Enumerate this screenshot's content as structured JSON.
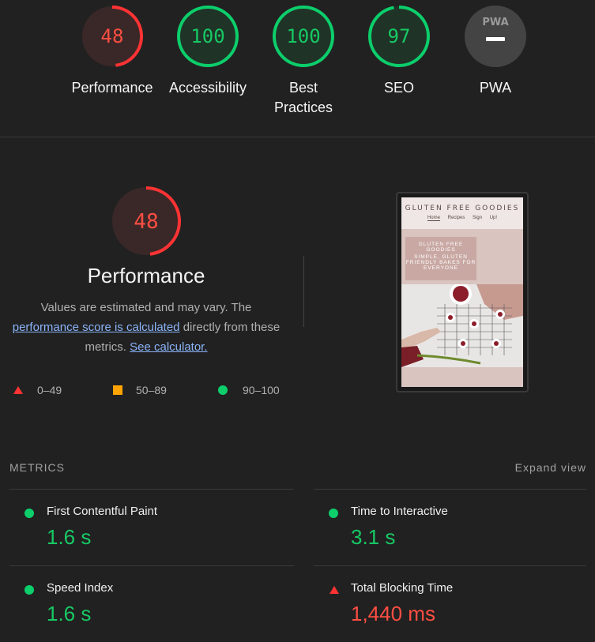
{
  "gauges": [
    {
      "score": "48",
      "label": "Performance",
      "status": "fail",
      "fraction": 0.48
    },
    {
      "score": "100",
      "label": "Accessibility",
      "status": "pass",
      "fraction": 1.0
    },
    {
      "score": "100",
      "label": "Best Practices",
      "status": "pass",
      "fraction": 1.0
    },
    {
      "score": "97",
      "label": "SEO",
      "status": "pass",
      "fraction": 0.97
    },
    {
      "score": "",
      "label": "PWA",
      "status": "na",
      "badge": "PWA"
    }
  ],
  "performance": {
    "score": "48",
    "fraction": 0.48,
    "title": "Performance",
    "desc_before": "Values are estimated and may vary. The",
    "desc_link": "performance score is calculated",
    "desc_middle": "directly from these metrics.",
    "desc_link2": "See calculator."
  },
  "legend": [
    {
      "icon": "triangle-icon",
      "range": "0–49",
      "color": "#ff3333"
    },
    {
      "icon": "square-icon",
      "range": "50–89",
      "color": "#ffa400"
    },
    {
      "icon": "circle-icon",
      "range": "90–100",
      "color": "#0cce6b"
    }
  ],
  "screenshot": {
    "site_title": "GLUTEN FREE GOODIES",
    "nav": [
      "Home",
      "Recipes",
      "Sign Up!"
    ],
    "hero_title": "GLUTEN FREE GOODIES",
    "hero_sub": "SIMPLE, GLUTEN FRIENDLY BAKES FOR EVERYONE"
  },
  "metrics": {
    "header": "METRICS",
    "expand": "Expand view",
    "items": [
      {
        "name": "First Contentful Paint",
        "value": "1.6 s",
        "status": "pass"
      },
      {
        "name": "Time to Interactive",
        "value": "3.1 s",
        "status": "pass"
      },
      {
        "name": "Speed Index",
        "value": "1.6 s",
        "status": "pass"
      },
      {
        "name": "Total Blocking Time",
        "value": "1,440 ms",
        "status": "fail"
      }
    ]
  },
  "colors": {
    "pass": "#0cce6b",
    "fail": "#ff3333",
    "average": "#ffa400"
  }
}
